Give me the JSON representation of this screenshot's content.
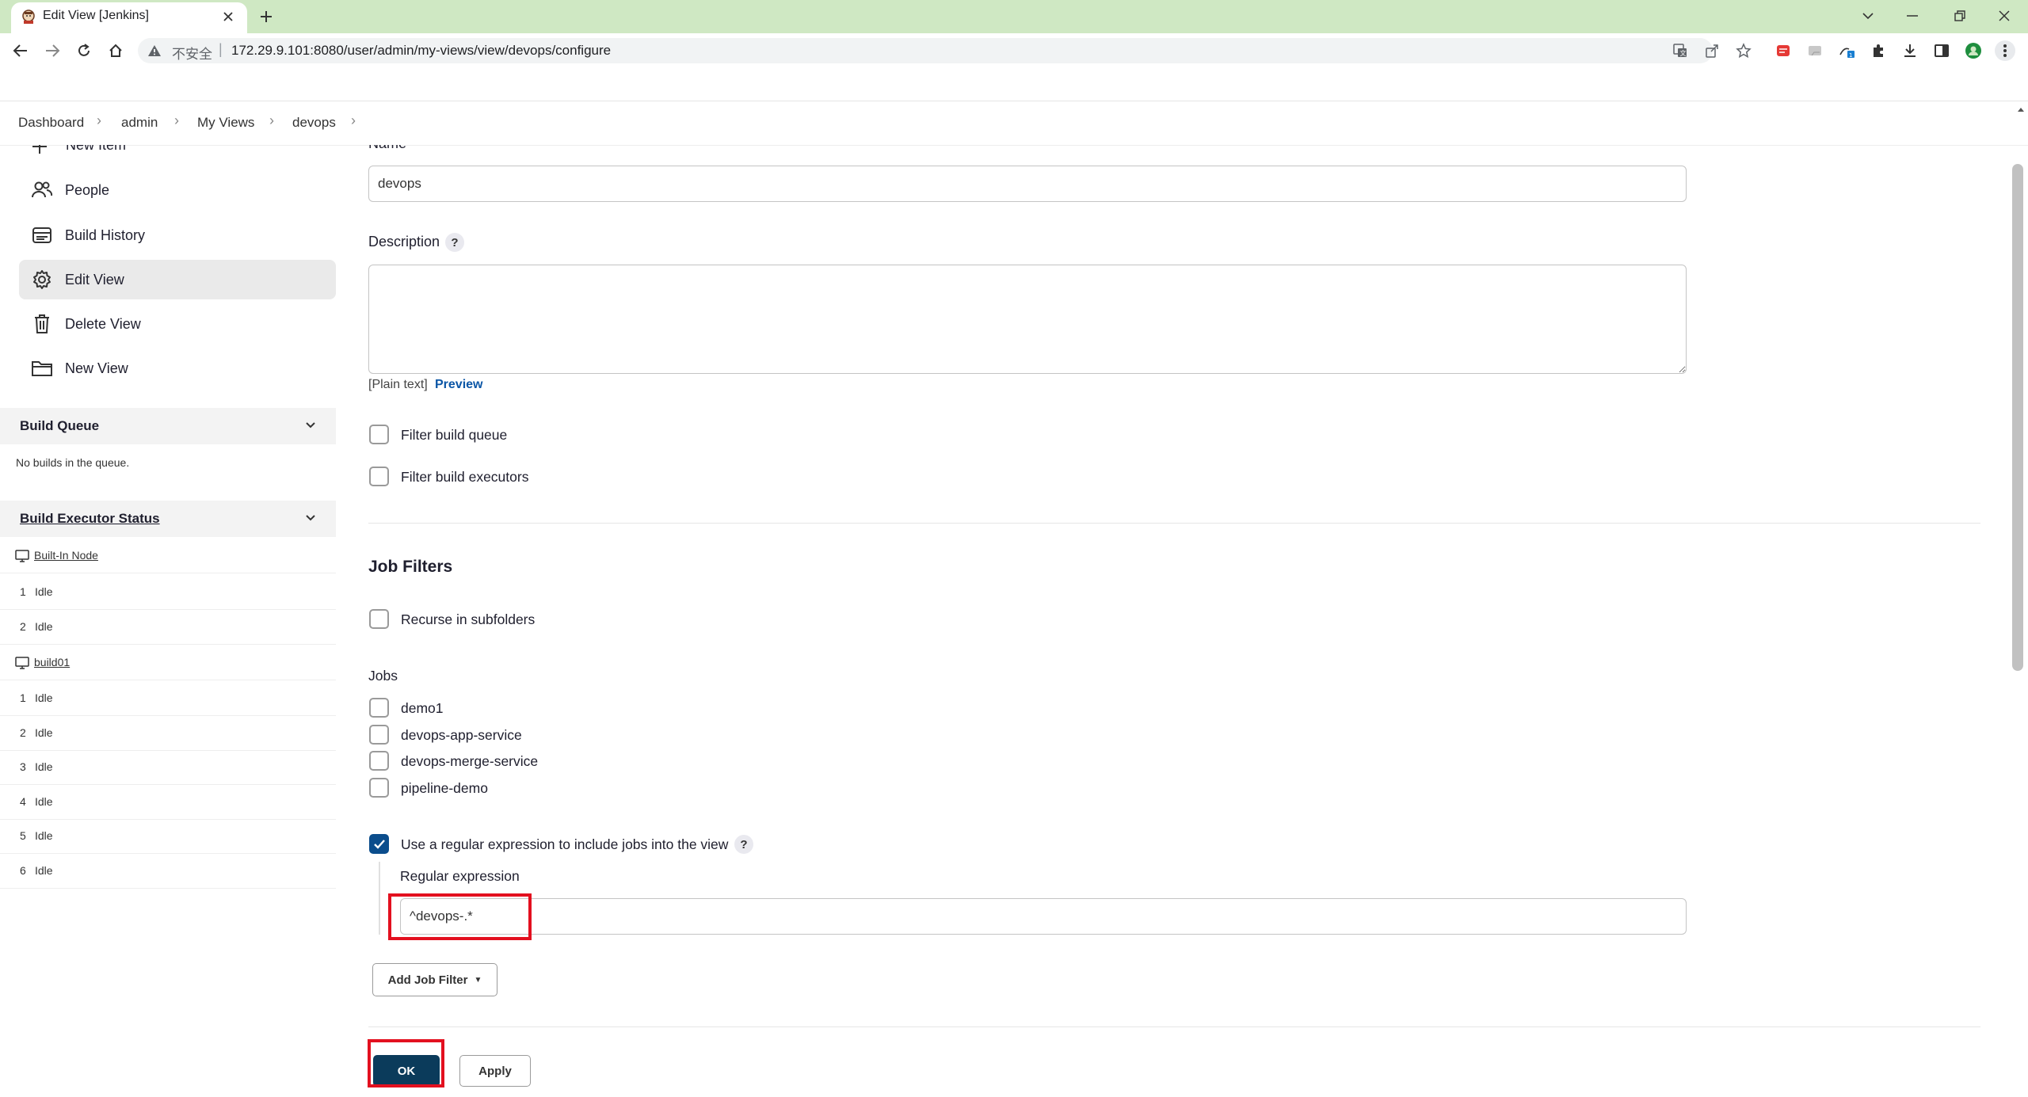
{
  "browser": {
    "tab_title": "Edit View [Jenkins]",
    "insecure_label": "不安全",
    "address_separator": "|",
    "url": "172.29.9.101:8080/user/admin/my-views/view/devops/configure"
  },
  "breadcrumbs": [
    {
      "label": "Dashboard"
    },
    {
      "label": "admin"
    },
    {
      "label": "My Views"
    },
    {
      "label": "devops"
    }
  ],
  "sidebar": {
    "items": [
      {
        "label": "New Item",
        "icon": "plus-icon"
      },
      {
        "label": "People",
        "icon": "people-icon"
      },
      {
        "label": "Build History",
        "icon": "build-history-icon"
      },
      {
        "label": "Edit View",
        "icon": "gear-icon"
      },
      {
        "label": "Delete View",
        "icon": "trash-icon"
      },
      {
        "label": "New View",
        "icon": "folder-icon"
      }
    ],
    "build_queue": {
      "title": "Build Queue",
      "empty_text": "No builds in the queue."
    },
    "executor_status": {
      "title": "Build Executor Status",
      "nodes": [
        {
          "name": "Built-In Node",
          "executors": [
            {
              "num": "1",
              "status": "Idle"
            },
            {
              "num": "2",
              "status": "Idle"
            }
          ]
        },
        {
          "name": "build01",
          "executors": [
            {
              "num": "1",
              "status": "Idle"
            },
            {
              "num": "2",
              "status": "Idle"
            },
            {
              "num": "3",
              "status": "Idle"
            },
            {
              "num": "4",
              "status": "Idle"
            },
            {
              "num": "5",
              "status": "Idle"
            },
            {
              "num": "6",
              "status": "Idle"
            }
          ]
        }
      ]
    }
  },
  "form": {
    "name_label": "Name",
    "name_value": "devops",
    "description_label": "Description",
    "description_value": "",
    "help_symbol": "?",
    "plain_text_note": "[Plain text]",
    "preview_link": "Preview",
    "filter_build_queue": {
      "label": "Filter build queue",
      "checked": false
    },
    "filter_build_executors": {
      "label": "Filter build executors",
      "checked": false
    },
    "job_filters_title": "Job Filters",
    "recurse_subfolders": {
      "label": "Recurse in subfolders",
      "checked": false
    },
    "jobs_label": "Jobs",
    "jobs": [
      {
        "label": "demo1",
        "checked": false
      },
      {
        "label": "devops-app-service",
        "checked": false
      },
      {
        "label": "devops-merge-service",
        "checked": false
      },
      {
        "label": "pipeline-demo",
        "checked": false
      }
    ],
    "use_regex": {
      "label": "Use a regular expression to include jobs into the view",
      "checked": true
    },
    "regex_label": "Regular expression",
    "regex_value": "^devops-.*",
    "add_job_filter": "Add Job Filter",
    "ok_button": "OK",
    "apply_button": "Apply"
  },
  "colors": {
    "tab_strip": "#cfe8c3",
    "primary_button": "#0b3b5b",
    "checkbox_checked": "#0b4d8c",
    "link": "#0b56a6",
    "highlight": "#e3101f"
  }
}
